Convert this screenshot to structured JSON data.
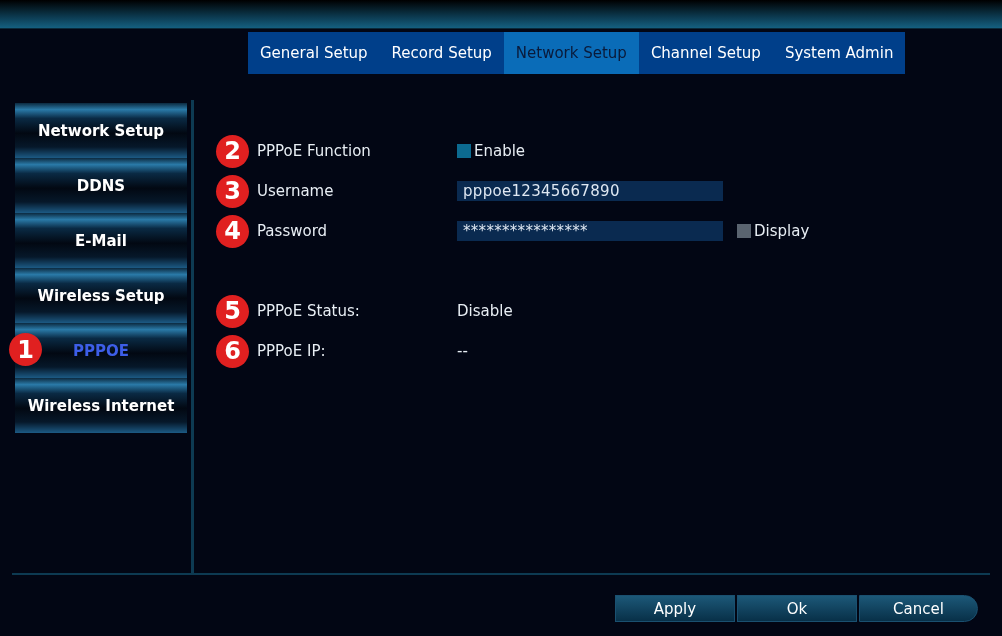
{
  "tabs": [
    {
      "label": "General Setup",
      "selected": false
    },
    {
      "label": "Record Setup",
      "selected": false
    },
    {
      "label": "Network Setup",
      "selected": true
    },
    {
      "label": "Channel Setup",
      "selected": false
    },
    {
      "label": "System Admin",
      "selected": false
    }
  ],
  "sidebar": {
    "items": [
      {
        "label": "Network Setup",
        "selected": false
      },
      {
        "label": "DDNS",
        "selected": false
      },
      {
        "label": "E-Mail",
        "selected": false
      },
      {
        "label": "Wireless Setup",
        "selected": false
      },
      {
        "label": "PPPOE",
        "selected": true,
        "callout": "1"
      },
      {
        "label": "Wireless Internet",
        "selected": false
      }
    ]
  },
  "form": {
    "rows": [
      {
        "kind": "checkbox",
        "callout": "2",
        "label": "PPPoE Function",
        "option": {
          "label": "Enable",
          "checked": true
        }
      },
      {
        "kind": "input",
        "callout": "3",
        "label": "Username",
        "value": "pppoe12345667890"
      },
      {
        "kind": "input",
        "callout": "4",
        "label": "Password",
        "value": "****************",
        "option": {
          "label": "Display",
          "checked": false
        }
      },
      {
        "kind": "spacer"
      },
      {
        "kind": "text",
        "callout": "5",
        "label": "PPPoE Status:",
        "value": "Disable"
      },
      {
        "kind": "text",
        "callout": "6",
        "label": "PPPoE IP:",
        "value": "--"
      }
    ]
  },
  "buttons": [
    "Apply",
    "Ok",
    "Cancel"
  ]
}
